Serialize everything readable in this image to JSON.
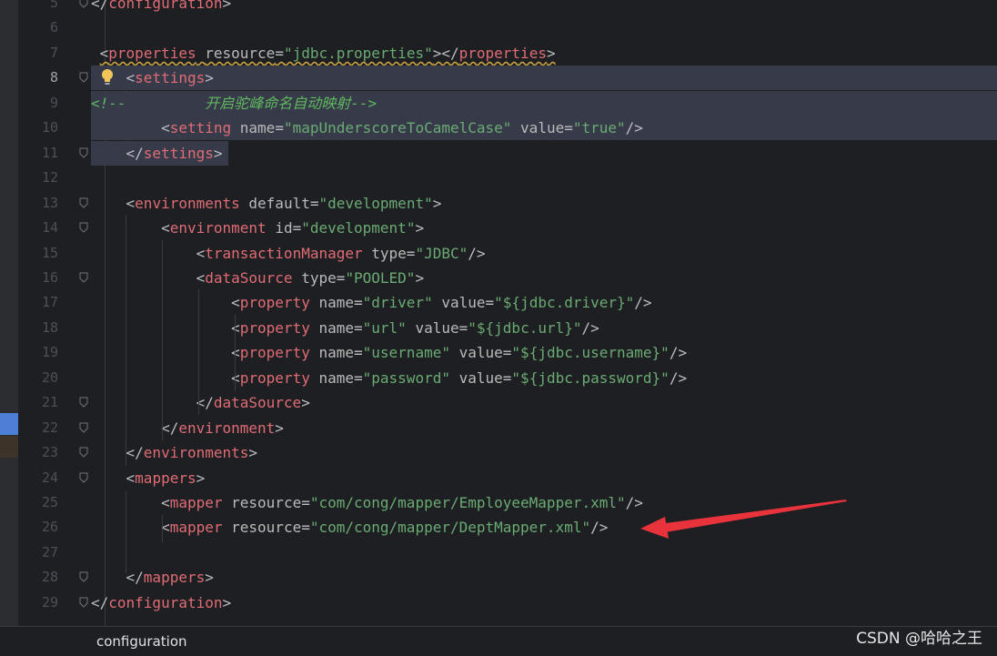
{
  "editor": {
    "lines": [
      {
        "num": "5",
        "html": "<span class=\"br\">&lt;/</span><span class=\"tn\">configuration</span><span class=\"br\">&gt;</span>"
      },
      {
        "num": "6",
        "html": ""
      },
      {
        "num": "7",
        "html": " <span class=\"warn\"><span class=\"br\">&lt;</span><span class=\"tn\">properties</span> <span class=\"an\">resource</span><span class=\"br\">=</span><span class=\"av\">\"jdbc.properties\"</span><span class=\"br\">&gt;&lt;/</span><span class=\"tn\">properties</span><span class=\"br\">&gt;</span></span>"
      },
      {
        "num": "8",
        "html": "    <span class=\"br\">&lt;</span><span class=\"tn\">settings</span><span class=\"br\">&gt;</span>",
        "current": true
      },
      {
        "num": "9",
        "html": "<span class=\"cm\">&lt;!--         开启驼峰命名自动映射--&gt;</span>"
      },
      {
        "num": "10",
        "html": "        <span class=\"br\">&lt;</span><span class=\"tn\">setting</span> <span class=\"an\">name</span><span class=\"br\">=</span><span class=\"av\">\"mapUnderscoreToCamelCase\"</span> <span class=\"an\">value</span><span class=\"br\">=</span><span class=\"av\">\"true\"</span><span class=\"br\">/&gt;</span>"
      },
      {
        "num": "11",
        "html": "    <span class=\"br\">&lt;/</span><span class=\"tn\">settings</span><span class=\"br\">&gt;</span>"
      },
      {
        "num": "12",
        "html": ""
      },
      {
        "num": "13",
        "html": "    <span class=\"br\">&lt;</span><span class=\"tn\">environments</span> <span class=\"an\">default</span><span class=\"br\">=</span><span class=\"av\">\"development\"</span><span class=\"br\">&gt;</span>"
      },
      {
        "num": "14",
        "html": "        <span class=\"br\">&lt;</span><span class=\"tn\">environment</span> <span class=\"an\">id</span><span class=\"br\">=</span><span class=\"av\">\"development\"</span><span class=\"br\">&gt;</span>"
      },
      {
        "num": "15",
        "html": "            <span class=\"br\">&lt;</span><span class=\"tn\">transactionManager</span> <span class=\"an\">type</span><span class=\"br\">=</span><span class=\"av\">\"JDBC\"</span><span class=\"br\">/&gt;</span>"
      },
      {
        "num": "16",
        "html": "            <span class=\"br\">&lt;</span><span class=\"tn\">dataSource</span> <span class=\"an\">type</span><span class=\"br\">=</span><span class=\"av\">\"POOLED\"</span><span class=\"br\">&gt;</span>"
      },
      {
        "num": "17",
        "html": "                <span class=\"br\">&lt;</span><span class=\"tn\">property</span> <span class=\"an\">name</span><span class=\"br\">=</span><span class=\"av\">\"driver\"</span> <span class=\"an\">value</span><span class=\"br\">=</span><span class=\"av\">\"${jdbc.driver}\"</span><span class=\"br\">/&gt;</span>"
      },
      {
        "num": "18",
        "html": "                <span class=\"br\">&lt;</span><span class=\"tn\">property</span> <span class=\"an\">name</span><span class=\"br\">=</span><span class=\"av\">\"url\"</span> <span class=\"an\">value</span><span class=\"br\">=</span><span class=\"av\">\"${jdbc.url}\"</span><span class=\"br\">/&gt;</span>"
      },
      {
        "num": "19",
        "html": "                <span class=\"br\">&lt;</span><span class=\"tn\">property</span> <span class=\"an\">name</span><span class=\"br\">=</span><span class=\"av\">\"username\"</span> <span class=\"an\">value</span><span class=\"br\">=</span><span class=\"av\">\"${jdbc.username}\"</span><span class=\"br\">/&gt;</span>"
      },
      {
        "num": "20",
        "html": "                <span class=\"br\">&lt;</span><span class=\"tn\">property</span> <span class=\"an\">name</span><span class=\"br\">=</span><span class=\"av\">\"password\"</span> <span class=\"an\">value</span><span class=\"br\">=</span><span class=\"av\">\"${jdbc.password}\"</span><span class=\"br\">/&gt;</span>"
      },
      {
        "num": "21",
        "html": "            <span class=\"br\">&lt;/</span><span class=\"tn\">dataSource</span><span class=\"br\">&gt;</span>"
      },
      {
        "num": "22",
        "html": "        <span class=\"br\">&lt;/</span><span class=\"tn\">environment</span><span class=\"br\">&gt;</span>"
      },
      {
        "num": "23",
        "html": "    <span class=\"br\">&lt;/</span><span class=\"tn\">environments</span><span class=\"br\">&gt;</span>"
      },
      {
        "num": "24",
        "html": "    <span class=\"br\">&lt;</span><span class=\"tn\">mappers</span><span class=\"br\">&gt;</span>"
      },
      {
        "num": "25",
        "html": "        <span class=\"br\">&lt;</span><span class=\"tn\">mapper</span> <span class=\"an\">resource</span><span class=\"br\">=</span><span class=\"av\">\"com/cong/mapper/EmployeeMapper.xml\"</span><span class=\"br\">/&gt;</span>"
      },
      {
        "num": "26",
        "html": "        <span class=\"br\">&lt;</span><span class=\"tn\">mapper</span> <span class=\"an\">resource</span><span class=\"br\">=</span><span class=\"av\">\"com/cong/mapper/DeptMapper.xml\"</span><span class=\"br\">/&gt;</span>"
      },
      {
        "num": "27",
        "html": ""
      },
      {
        "num": "28",
        "html": "    <span class=\"br\">&lt;/</span><span class=\"tn\">mappers</span><span class=\"br\">&gt;</span>"
      },
      {
        "num": "29",
        "html": "<span class=\"br\">&lt;/</span><span class=\"tn\">configuration</span><span class=\"br\">&gt;</span>"
      }
    ],
    "code_text": [
      "</configuration>",
      "",
      " <properties resource=\"jdbc.properties\"></properties>",
      "    <settings>",
      "<!--         开启驼峰命名自动映射-->",
      "        <setting name=\"mapUnderscoreToCamelCase\" value=\"true\"/>",
      "    </settings>",
      "",
      "    <environments default=\"development\">",
      "        <environment id=\"development\">",
      "            <transactionManager type=\"JDBC\"/>",
      "            <dataSource type=\"POOLED\">",
      "                <property name=\"driver\" value=\"${jdbc.driver}\"/>",
      "                <property name=\"url\" value=\"${jdbc.url}\"/>",
      "                <property name=\"username\" value=\"${jdbc.username}\"/>",
      "                <property name=\"password\" value=\"${jdbc.password}\"/>",
      "            </dataSource>",
      "        </environment>",
      "    </environments>",
      "    <mappers>",
      "        <mapper resource=\"com/cong/mapper/EmployeeMapper.xml\"/>",
      "        <mapper resource=\"com/cong/mapper/DeptMapper.xml\"/>",
      "",
      "    </mappers>",
      "</configuration>"
    ],
    "fold_lines": [
      "5",
      "8",
      "11",
      "13",
      "14",
      "16",
      "21",
      "22",
      "23",
      "24",
      "28",
      "29"
    ],
    "highlighted_lines": [
      "8",
      "9",
      "10",
      "11"
    ]
  },
  "breadcrumb": "configuration",
  "watermark": "CSDN @哈哈之王",
  "colors": {
    "tag": "#e06c75",
    "attribute_name": "#bababa",
    "attribute_value": "#6aab73",
    "comment": "#5fb85f",
    "annotation_arrow": "#e8323c"
  }
}
